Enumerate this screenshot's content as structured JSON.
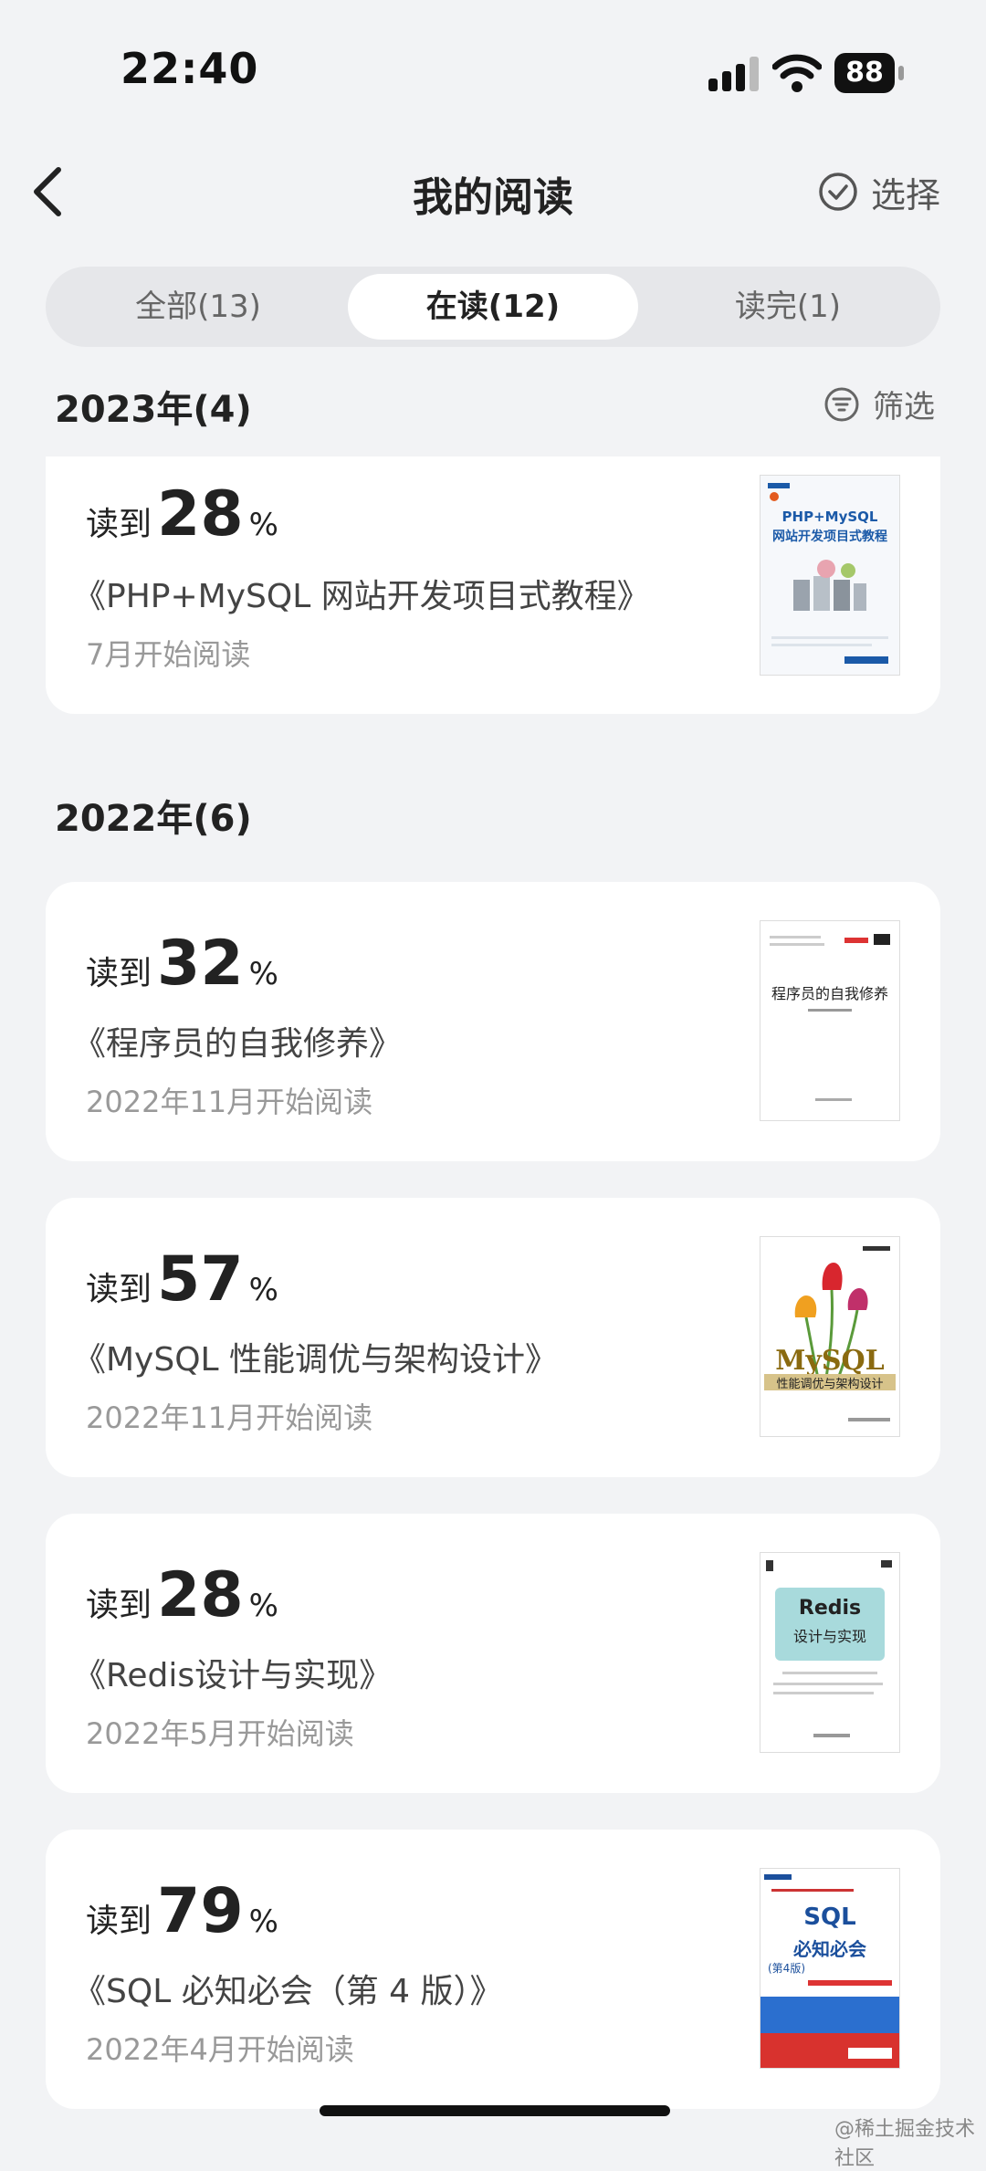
{
  "status": {
    "time": "22:40",
    "battery": "88"
  },
  "nav": {
    "title": "我的阅读",
    "select_label": "选择"
  },
  "tabs": [
    {
      "label": "全部(13)"
    },
    {
      "label": "在读(12)"
    },
    {
      "label": "读完(1)"
    }
  ],
  "sections": [
    {
      "title": "2023年(4)"
    },
    {
      "title": "2022年(6)"
    }
  ],
  "filter": {
    "label": "筛选"
  },
  "cards": [
    {
      "prefix": "读到",
      "progress": "28",
      "unit": "%",
      "book": "《PHP+MySQL 网站开发项目式教程》",
      "start": "7月开始阅读",
      "cover_title_1": "PHP+MySQL",
      "cover_title_2": "网站开发项目式教程"
    },
    {
      "prefix": "读到",
      "progress": "32",
      "unit": "%",
      "book": "《程序员的自我修养》",
      "start": "2022年11月开始阅读",
      "cover_title_1": "程序员的自我修养"
    },
    {
      "prefix": "读到",
      "progress": "57",
      "unit": "%",
      "book": "《MySQL 性能调优与架构设计》",
      "start": "2022年11月开始阅读",
      "cover_title_1": "MySQL",
      "cover_title_2": "性能调优与架构设计"
    },
    {
      "prefix": "读到",
      "progress": "28",
      "unit": "%",
      "book": "《Redis设计与实现》",
      "start": "2022年5月开始阅读",
      "cover_title_1": "Redis",
      "cover_title_2": "设计与实现"
    },
    {
      "prefix": "读到",
      "progress": "79",
      "unit": "%",
      "book": "《SQL 必知必会（第 4 版）》",
      "start": "2022年4月开始阅读",
      "cover_title_1": "SQL",
      "cover_title_2": "必知必会",
      "cover_title_3": "(第4版)"
    }
  ],
  "watermark": "@稀土掘金技术社区",
  "colors": {
    "background": "#f2f3f5",
    "card": "#ffffff",
    "tab_track": "#e6e7ea"
  }
}
